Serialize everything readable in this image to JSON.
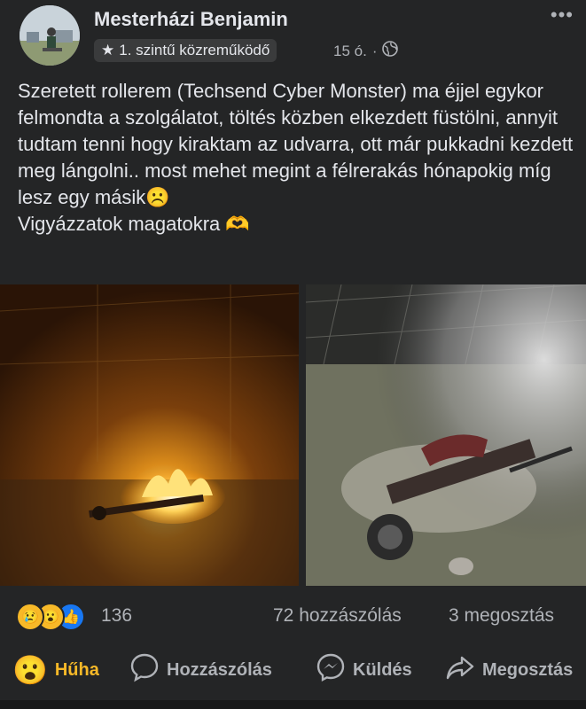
{
  "post": {
    "author": "Mesterházi Benjamin",
    "badge": "1. szintű közreműködő",
    "time": "15 ó.",
    "separator": "·",
    "more_label": "•••",
    "text": "Szeretett rollerem (Techsend Cyber Monster) ma éjjel egykor felmondta a szolgálatot, töltés közben elkezdett füstölni, annyit tudtam tenni hogy kiraktam az udvarra, ott már pukkadni kezdett meg lángolni.. most mehet megint a félrerakás hónapokig míg lesz egy másik☹️\nVigyázzatok magatokra 🫶"
  },
  "stats": {
    "reaction_count": "136",
    "comments": "72 hozzászólás",
    "shares": "3 megosztás"
  },
  "actions": {
    "reaction_label": "Hűha",
    "comment_label": "Hozzászólás",
    "send_label": "Küldés",
    "share_label": "Megosztás"
  },
  "colors": {
    "background": "#242526",
    "text": "#e4e6eb",
    "secondary": "#b0b3b8",
    "reaction_active": "#f7b928",
    "like_blue": "#1877f2"
  }
}
